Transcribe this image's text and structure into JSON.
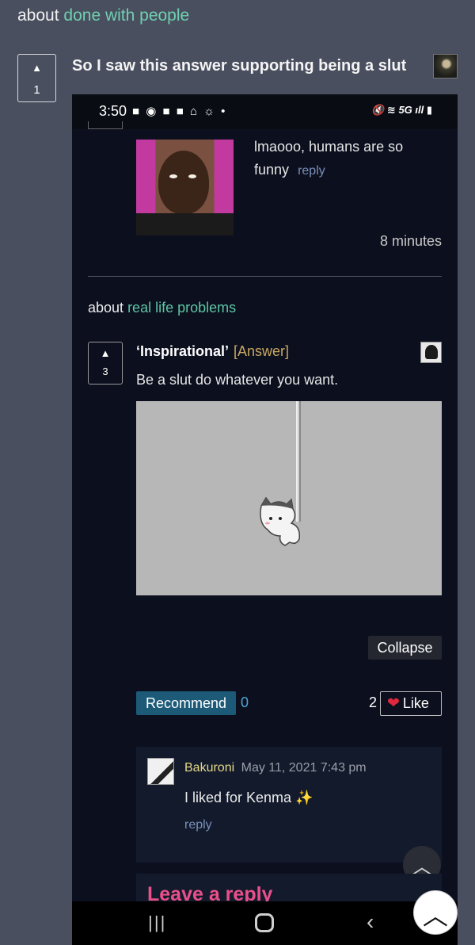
{
  "topic": {
    "prefix": "about",
    "link": "done with people"
  },
  "post": {
    "votes": "1",
    "title": "So I saw this answer supporting being a slut"
  },
  "phone": {
    "status": {
      "time": "3:50",
      "network": "5G"
    },
    "comment1": {
      "text": "lmaooo, humans are so funny",
      "reply": "reply",
      "time_ago": "8 minutes"
    },
    "about2": {
      "prefix": "about",
      "link": "real life problems"
    },
    "answer": {
      "votes": "3",
      "title": "‘Inspirational’",
      "tag": "[Answer]",
      "body": "Be a slut do whatever you want."
    },
    "collapse": "Collapse",
    "recommend": {
      "label": "Recommend",
      "count": "0"
    },
    "like": {
      "count": "2",
      "label": "Like"
    },
    "reply": {
      "author": "Bakuroni",
      "date": "May 11, 2021 7:43 pm",
      "text": "I liked for Kenma",
      "reply_link": "reply"
    },
    "leave_reply": "Leave a reply"
  },
  "colors": {
    "link_green": "#6fd0b0",
    "like_heart": "#e0283c",
    "recommend_bg": "#1c5a78",
    "leave_reply_pink": "#e9508a"
  }
}
